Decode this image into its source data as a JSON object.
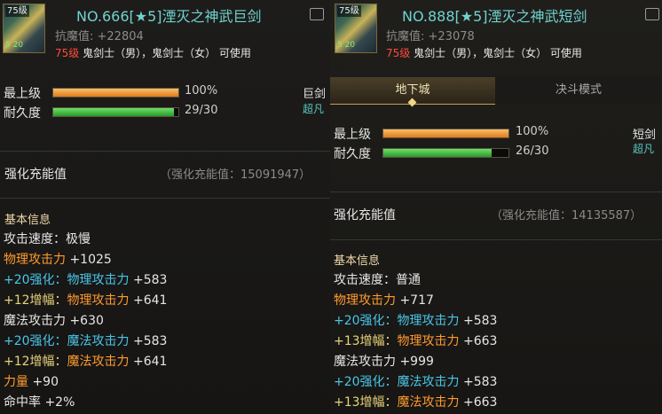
{
  "left": {
    "thumb_level": "75级",
    "thumb_sub": "5 20",
    "name": "NO.666[★5]湮灭之神武巨剑",
    "resist": "抗魔值: +22804",
    "req_level": "75级",
    "req_text": "鬼剑士（男），鬼剑士（女） 可使用",
    "max_level_label": "最上级",
    "max_level_value": "100%",
    "max_level_fraction": 1.0,
    "durability_label": "耐久度",
    "durability_value": "29/30",
    "durability_fraction": 0.967,
    "weapon_type": "巨剑",
    "grade": "超凡",
    "charge_label": "强化充能值",
    "charge_value": "（强化充能值：15091947）",
    "basic_info": "基本信息",
    "stats": [
      [
        {
          "t": "攻击速度：极慢",
          "c": "w"
        }
      ],
      [
        {
          "t": "物理攻击力",
          "c": "o"
        },
        {
          "t": " +1025",
          "c": "w"
        }
      ],
      [
        {
          "t": "+20强化：",
          "c": "c"
        },
        {
          "t": "物理攻击力",
          "c": "c"
        },
        {
          "t": " +583",
          "c": "w"
        }
      ],
      [
        {
          "t": " +12增幅：",
          "c": "y"
        },
        {
          "t": "物理攻击力",
          "c": "o"
        },
        {
          "t": " +641",
          "c": "w"
        }
      ],
      [
        {
          "t": "魔法攻击力 +630",
          "c": "w"
        }
      ],
      [
        {
          "t": "+20强化：",
          "c": "c"
        },
        {
          "t": "魔法攻击力",
          "c": "c"
        },
        {
          "t": " +583",
          "c": "w"
        }
      ],
      [
        {
          "t": " +12增幅：",
          "c": "y"
        },
        {
          "t": "魔法攻击力",
          "c": "o"
        },
        {
          "t": " +641",
          "c": "w"
        }
      ],
      [
        {
          "t": "力量",
          "c": "o"
        },
        {
          "t": " +90",
          "c": "w"
        }
      ],
      [
        {
          "t": "命中率 +2%",
          "c": "w"
        }
      ]
    ]
  },
  "right": {
    "thumb_level": "75级",
    "thumb_sub": "5 20",
    "name": "NO.888[★5]湮灭之神武短剑",
    "resist": "抗魔值: +23078",
    "req_level": "75级",
    "req_text": "鬼剑士（男），鬼剑士（女） 可使用",
    "tabs": [
      "地下城",
      "决斗模式"
    ],
    "max_level_label": "最上级",
    "max_level_value": "100%",
    "max_level_fraction": 1.0,
    "durability_label": "耐久度",
    "durability_value": "26/30",
    "durability_fraction": 0.867,
    "weapon_type": "短剑",
    "grade": "超凡",
    "charge_label": "强化充能值",
    "charge_value": "（强化充能值：14135587）",
    "basic_info": "基本信息",
    "stats": [
      [
        {
          "t": "攻击速度：普通",
          "c": "w"
        }
      ],
      [
        {
          "t": "物理攻击力",
          "c": "o"
        },
        {
          "t": " +717",
          "c": "w"
        }
      ],
      [
        {
          "t": "+20强化：",
          "c": "c"
        },
        {
          "t": "物理攻击力",
          "c": "c"
        },
        {
          "t": " +583",
          "c": "w"
        }
      ],
      [
        {
          "t": " +13增幅：",
          "c": "y"
        },
        {
          "t": "物理攻击力",
          "c": "o"
        },
        {
          "t": " +663",
          "c": "w"
        }
      ],
      [
        {
          "t": "魔法攻击力 +999",
          "c": "w"
        }
      ],
      [
        {
          "t": "+20强化：",
          "c": "c"
        },
        {
          "t": "魔法攻击力",
          "c": "c"
        },
        {
          "t": " +583",
          "c": "w"
        }
      ],
      [
        {
          "t": " +13增幅：",
          "c": "y"
        },
        {
          "t": "魔法攻击力",
          "c": "o"
        },
        {
          "t": " +663",
          "c": "w"
        }
      ]
    ]
  }
}
